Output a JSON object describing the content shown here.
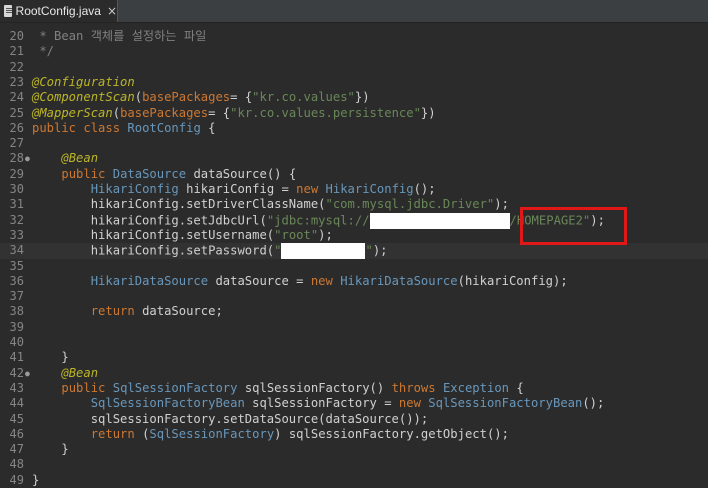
{
  "tab": {
    "title": "RootConfig.java",
    "close_glyph": "×",
    "icon": "java-file-icon"
  },
  "lines": [
    {
      "n": "20",
      "text": " * Bean 객체를 설정하는 파일"
    },
    {
      "n": "21",
      "text": " */"
    },
    {
      "n": "22",
      "text": ""
    },
    {
      "n": "23",
      "text": "@Configuration"
    },
    {
      "n": "24",
      "text": "@ComponentScan(basePackages= {\"kr.co.values\"})"
    },
    {
      "n": "25",
      "text": "@MapperScan(basePackages= {\"kr.co.values.persistence\"})"
    },
    {
      "n": "26",
      "text": "public class RootConfig {"
    },
    {
      "n": "27",
      "text": ""
    },
    {
      "n": "28",
      "text": "    @Bean"
    },
    {
      "n": "29",
      "text": "    public DataSource dataSource() {"
    },
    {
      "n": "30",
      "text": "        HikariConfig hikariConfig = new HikariConfig();"
    },
    {
      "n": "31",
      "text": "        hikariConfig.setDriverClassName(\"com.mysql.jdbc.Driver\");"
    },
    {
      "n": "32",
      "text": "        hikariConfig.setJdbcUrl(\"jdbc:mysql://[redacted]/HOMEPAGE2\");"
    },
    {
      "n": "33",
      "text": "        hikariConfig.setUsername(\"root\");"
    },
    {
      "n": "34",
      "text": "        hikariConfig.setPassword(\"[redacted]\");"
    },
    {
      "n": "35",
      "text": ""
    },
    {
      "n": "36",
      "text": "        HikariDataSource dataSource = new HikariDataSource(hikariConfig);"
    },
    {
      "n": "37",
      "text": ""
    },
    {
      "n": "38",
      "text": "        return dataSource;"
    },
    {
      "n": "39",
      "text": ""
    },
    {
      "n": "40",
      "text": ""
    },
    {
      "n": "41",
      "text": "    }"
    },
    {
      "n": "42",
      "text": "    @Bean"
    },
    {
      "n": "43",
      "text": "    public SqlSessionFactory sqlSessionFactory() throws Exception {"
    },
    {
      "n": "44",
      "text": "        SqlSessionFactoryBean sqlSessionFactory = new SqlSessionFactoryBean();"
    },
    {
      "n": "45",
      "text": "        sqlSessionFactory.setDataSource(dataSource());"
    },
    {
      "n": "46",
      "text": "        return (SqlSessionFactory) sqlSessionFactory.getObject();"
    },
    {
      "n": "47",
      "text": "    }"
    },
    {
      "n": "48",
      "text": ""
    },
    {
      "n": "49",
      "text": "}"
    }
  ],
  "colors": {
    "background": "#2b2b2b",
    "keyword": "#cc7832",
    "annotation": "#bbb529",
    "string": "#6a8759",
    "type": "#6897bb",
    "comment": "#808080",
    "highlight_box": "#e01818"
  },
  "redactions": [
    "jdbc-host-redacted",
    "password-redacted"
  ]
}
